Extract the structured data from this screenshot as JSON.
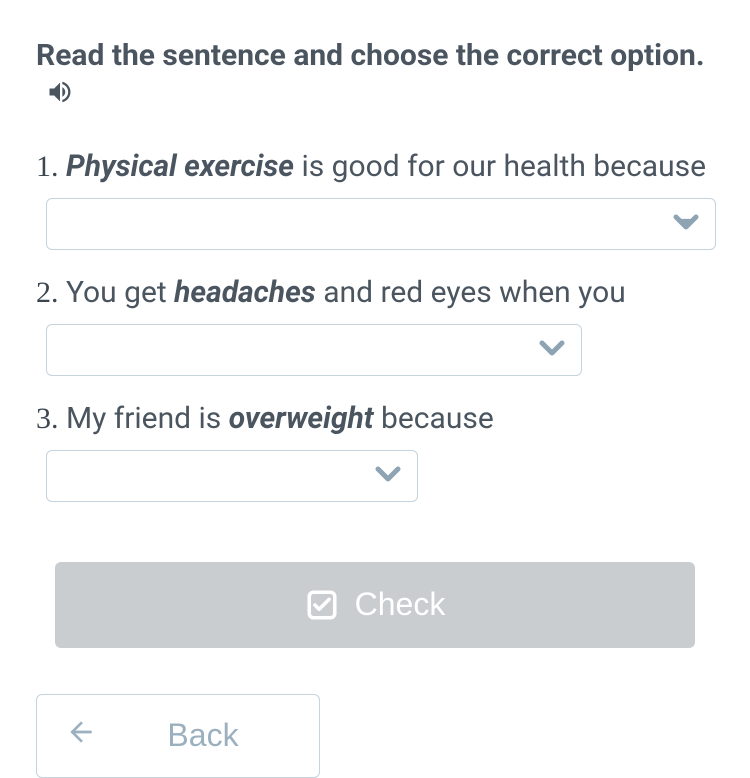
{
  "instruction": "Read the sentence and choose the correct option.",
  "questions": [
    {
      "number": "1.",
      "parts": [
        {
          "text": "Physical exercise",
          "emphasis": true
        },
        {
          "text": " is good for our health because",
          "emphasis": false
        }
      ]
    },
    {
      "number": "2.",
      "parts": [
        {
          "text": " You get ",
          "emphasis": false
        },
        {
          "text": "headaches",
          "emphasis": true
        },
        {
          "text": " and red eyes when you",
          "emphasis": false
        }
      ]
    },
    {
      "number": "3.",
      "parts": [
        {
          "text": " My friend is ",
          "emphasis": false
        },
        {
          "text": "overweight",
          "emphasis": true
        },
        {
          "text": " because",
          "emphasis": false
        }
      ]
    }
  ],
  "buttons": {
    "check": "Check",
    "back": "Back"
  }
}
